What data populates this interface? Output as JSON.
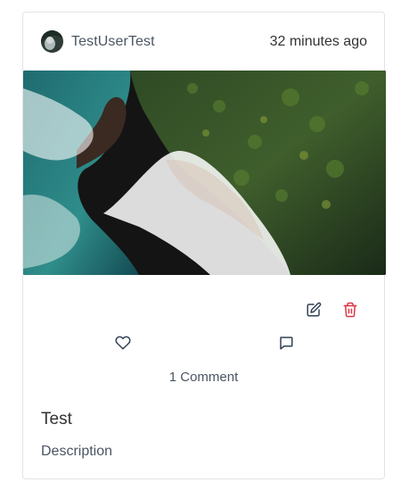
{
  "post": {
    "username": "TestUserTest",
    "timestamp": "32 minutes ago",
    "comments_label": "1 Comment",
    "title": "Test",
    "description": "Description"
  },
  "icons": {
    "avatar": "user-avatar",
    "edit": "edit-icon",
    "delete": "trash-icon",
    "like": "heart-icon",
    "comment": "comment-icon"
  },
  "colors": {
    "edit_icon": "#334155",
    "delete_icon": "#dc3545",
    "text_muted": "#4b5563"
  }
}
